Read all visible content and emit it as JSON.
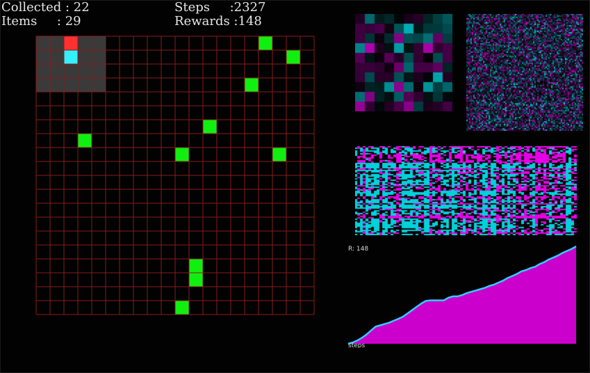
{
  "hud": {
    "collected_label": "Collected : ",
    "collected_value": "22",
    "items_label": "Items     : ",
    "items_value": "29",
    "steps_label": "Steps     :",
    "steps_value": "2327",
    "rewards_label": "Rewards :",
    "rewards_value": "148"
  },
  "grid": {
    "cols": 20,
    "rows": 20,
    "line_color": "#8b1a1a",
    "view_window": {
      "col": 0,
      "row": 0,
      "cols": 5,
      "rows": 4,
      "color": "#3a3a3a"
    },
    "agent": {
      "col": 2,
      "row": 1,
      "color": "#33f0ff"
    },
    "marker": {
      "col": 2,
      "row": 0,
      "color": "#ff3030"
    },
    "items_color": "#10f010",
    "items": [
      [
        16,
        0
      ],
      [
        18,
        1
      ],
      [
        15,
        3
      ],
      [
        12,
        6
      ],
      [
        3,
        7
      ],
      [
        10,
        8
      ],
      [
        17,
        8
      ],
      [
        11,
        16
      ],
      [
        11,
        17
      ],
      [
        10,
        19
      ]
    ]
  },
  "viz": {
    "weights_small_label": "",
    "weights_large_label": "",
    "activations_label": ""
  },
  "reward_chart": {
    "label": "R: 148",
    "xlabel": "steps",
    "fill_color": "#cc00cc",
    "line_color": "#33ccff"
  },
  "chart_data": {
    "type": "area",
    "title": "R: 148",
    "xlabel": "steps",
    "ylabel": "",
    "y": [
      0,
      2,
      5,
      9,
      14,
      20,
      26,
      28,
      30,
      32,
      35,
      38,
      41,
      46,
      51,
      56,
      61,
      65,
      66,
      66,
      66,
      66,
      70,
      72,
      72,
      74,
      77,
      79,
      81,
      83,
      85,
      88,
      90,
      93,
      96,
      100,
      103,
      106,
      110,
      112,
      115,
      117,
      121,
      124,
      128,
      131,
      134,
      138,
      141,
      144,
      148
    ],
    "ylim": [
      0,
      148
    ]
  }
}
